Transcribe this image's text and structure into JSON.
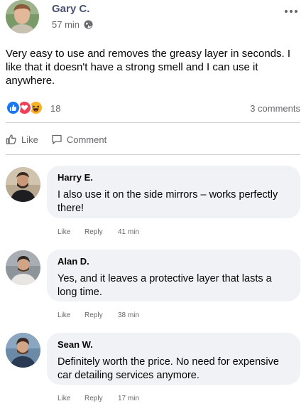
{
  "post": {
    "author": "Gary C.",
    "time": "57 min",
    "text": "Very easy to use and removes the greasy layer in seconds. I like that it doesn't have a strong smell and I can use it anywhere.",
    "reaction_count": "18",
    "comments_count": "3 comments"
  },
  "actions": {
    "like": "Like",
    "comment": "Comment"
  },
  "comments": [
    {
      "name": "Harry E.",
      "text": "I also use it on the side mirrors – works perfectly there!",
      "like": "Like",
      "reply": "Reply",
      "time": "41 min"
    },
    {
      "name": "Alan D.",
      "text": "Yes, and it leaves a protective layer that lasts a long time.",
      "like": "Like",
      "reply": "Reply",
      "time": "38 min"
    },
    {
      "name": "Sean W.",
      "text": "Definitely worth the price. No need for expensive car detailing services anymore.",
      "like": "Like",
      "reply": "Reply",
      "time": "17 min"
    }
  ],
  "colors": {
    "author_name": "#4a5270",
    "bubble_bg": "#f0f2f5",
    "muted_text": "#65676b",
    "like_blue": "#1877f2",
    "love_red": "#f33e58",
    "haha_yellow": "#f7b125"
  }
}
